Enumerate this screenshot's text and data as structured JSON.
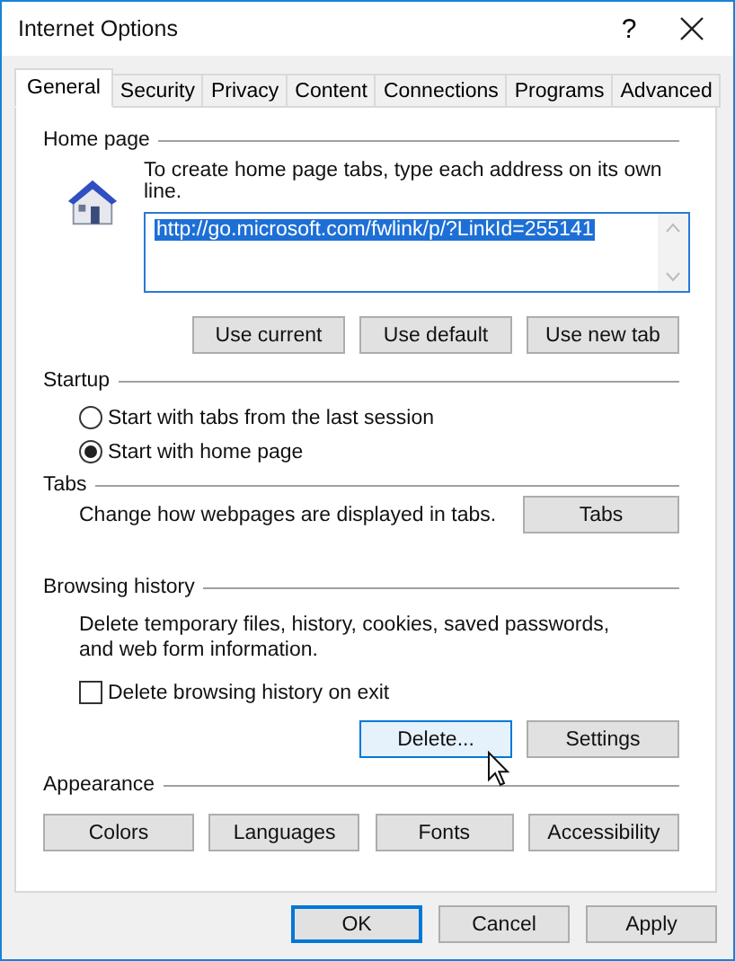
{
  "window": {
    "title": "Internet Options",
    "help": "?"
  },
  "tabs": [
    {
      "label": "General",
      "selected": true
    },
    {
      "label": "Security",
      "selected": false
    },
    {
      "label": "Privacy",
      "selected": false
    },
    {
      "label": "Content",
      "selected": false
    },
    {
      "label": "Connections",
      "selected": false
    },
    {
      "label": "Programs",
      "selected": false
    },
    {
      "label": "Advanced",
      "selected": false
    }
  ],
  "home_page": {
    "heading": "Home page",
    "description": "To create home page tabs, type each address on its own line.",
    "address": "http://go.microsoft.com/fwlink/p/?LinkId=255141",
    "address_selected": true,
    "buttons": [
      {
        "label": "Use current"
      },
      {
        "label": "Use default"
      },
      {
        "label": "Use new tab"
      }
    ]
  },
  "startup": {
    "heading": "Startup",
    "options": [
      {
        "label": "Start with tabs from the last session",
        "selected": false
      },
      {
        "label": "Start with home page",
        "selected": true
      }
    ]
  },
  "tabs_group": {
    "heading": "Tabs",
    "description": "Change how webpages are displayed in tabs.",
    "button": "Tabs"
  },
  "browsing_history": {
    "heading": "Browsing history",
    "description": "Delete temporary files, history, cookies, saved passwords, and web form information.",
    "checkbox": {
      "label": "Delete browsing history on exit",
      "checked": false
    },
    "buttons": [
      {
        "label": "Delete...",
        "hovered": true
      },
      {
        "label": "Settings",
        "hovered": false
      }
    ]
  },
  "appearance": {
    "heading": "Appearance",
    "buttons": [
      {
        "label": "Colors"
      },
      {
        "label": "Languages"
      },
      {
        "label": "Fonts"
      },
      {
        "label": "Accessibility"
      }
    ]
  },
  "footer_buttons": [
    {
      "label": "OK",
      "default": true
    },
    {
      "label": "Cancel",
      "default": false
    },
    {
      "label": "Apply",
      "default": false
    }
  ]
}
